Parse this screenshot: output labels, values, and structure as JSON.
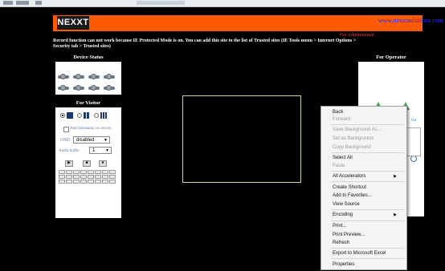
{
  "header": {
    "logo_text": "NEXXT",
    "site_url": "www.nexxtsolutions.com",
    "admin_link": "For Administrator",
    "brand_color": "#ff5a00"
  },
  "warning": "Record function can not work because IE Protected Mode is on. You can add this site to the list of Trusted sites (IE Tools menu > Internet Options > Security tab > Trusted sites)",
  "left_panel": {
    "device_status_title": "Device Status",
    "visitor_title": "For Visitor",
    "timestamp_label": "Add timestamp on record",
    "osd_label": "OSD",
    "osd_value": "disabled",
    "audio_buffer_label": "Audio buffer",
    "audio_buffer_value": "1"
  },
  "right_panel": {
    "operator_title": "For Operator",
    "go_label": "Go"
  },
  "context_menu": {
    "items": [
      {
        "label": "Back",
        "enabled": true
      },
      {
        "label": "Forward",
        "enabled": false
      },
      {
        "label": "Save Background As...",
        "enabled": false
      },
      {
        "label": "Set as Background",
        "enabled": false
      },
      {
        "label": "Copy Background",
        "enabled": false
      },
      {
        "label": "Select All",
        "enabled": true
      },
      {
        "label": "Paste",
        "enabled": false
      },
      {
        "label": "All Accelerators",
        "enabled": true,
        "submenu": true
      },
      {
        "label": "Create Shortcut",
        "enabled": true
      },
      {
        "label": "Add to Favorites...",
        "enabled": true
      },
      {
        "label": "View Source",
        "enabled": true
      },
      {
        "label": "Encoding",
        "enabled": true,
        "submenu": true
      },
      {
        "label": "Print...",
        "enabled": true
      },
      {
        "label": "Print Preview...",
        "enabled": true
      },
      {
        "label": "Refresh",
        "enabled": true
      },
      {
        "label": "Export to Microsoft Excel",
        "enabled": true
      },
      {
        "label": "Properties",
        "enabled": true
      }
    ]
  }
}
